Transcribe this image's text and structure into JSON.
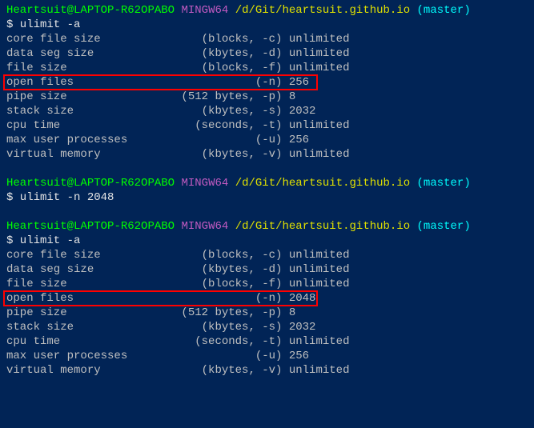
{
  "prompt": {
    "user": "Heartsuit",
    "at": "@",
    "host": "LAPTOP-R62OPABO",
    "shell": " MINGW64 ",
    "path": "/d/Git/heartsuit.github.io",
    "branch": " (master)"
  },
  "cmd1": "$ ulimit -a",
  "cmd2": "$ ulimit -n 2048",
  "cmd3": "$ ulimit -a",
  "out1": [
    {
      "name": "core file size",
      "flags": "(blocks, -c)",
      "value": "unlimited",
      "hl": false
    },
    {
      "name": "data seg size",
      "flags": "(kbytes, -d)",
      "value": "unlimited",
      "hl": false
    },
    {
      "name": "file size",
      "flags": "(blocks, -f)",
      "value": "unlimited",
      "hl": false
    },
    {
      "name": "open files",
      "flags": "(-n)",
      "value": "256",
      "hl": true
    },
    {
      "name": "pipe size",
      "flags": "(512 bytes, -p)",
      "value": "8",
      "hl": false
    },
    {
      "name": "stack size",
      "flags": "(kbytes, -s)",
      "value": "2032",
      "hl": false
    },
    {
      "name": "cpu time",
      "flags": "(seconds, -t)",
      "value": "unlimited",
      "hl": false
    },
    {
      "name": "max user processes",
      "flags": "(-u)",
      "value": "256",
      "hl": false
    },
    {
      "name": "virtual memory",
      "flags": "(kbytes, -v)",
      "value": "unlimited",
      "hl": false
    }
  ],
  "out2": [
    {
      "name": "core file size",
      "flags": "(blocks, -c)",
      "value": "unlimited",
      "hl": false
    },
    {
      "name": "data seg size",
      "flags": "(kbytes, -d)",
      "value": "unlimited",
      "hl": false
    },
    {
      "name": "file size",
      "flags": "(blocks, -f)",
      "value": "unlimited",
      "hl": false
    },
    {
      "name": "open files",
      "flags": "(-n)",
      "value": "2048",
      "hl": true
    },
    {
      "name": "pipe size",
      "flags": "(512 bytes, -p)",
      "value": "8",
      "hl": false
    },
    {
      "name": "stack size",
      "flags": "(kbytes, -s)",
      "value": "2032",
      "hl": false
    },
    {
      "name": "cpu time",
      "flags": "(seconds, -t)",
      "value": "unlimited",
      "hl": false
    },
    {
      "name": "max user processes",
      "flags": "(-u)",
      "value": "256",
      "hl": false
    },
    {
      "name": "virtual memory",
      "flags": "(kbytes, -v)",
      "value": "unlimited",
      "hl": false
    }
  ]
}
